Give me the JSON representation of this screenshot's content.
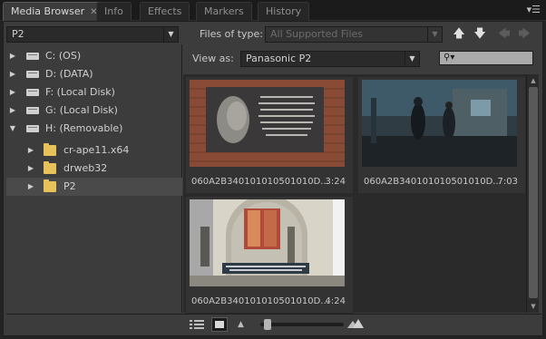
{
  "tabs": [
    {
      "label": "Media Browser",
      "active": true,
      "closable": true
    },
    {
      "label": "Info"
    },
    {
      "label": "Effects"
    },
    {
      "label": "Markers"
    },
    {
      "label": "History"
    }
  ],
  "panel_menu_icon": "panel-menu-icon",
  "location": {
    "value": "P2"
  },
  "files_of_type": {
    "label": "Files of type:",
    "value": "All Supported Files"
  },
  "view_as": {
    "label": "View as:",
    "value": "Panasonic P2"
  },
  "tree": [
    {
      "label": "C: (OS)",
      "type": "drive",
      "expanded": false
    },
    {
      "label": "D: (DATA)",
      "type": "drive",
      "expanded": false
    },
    {
      "label": "F: (Local Disk)",
      "type": "drive",
      "expanded": false
    },
    {
      "label": "G: (Local Disk)",
      "type": "drive",
      "expanded": false
    },
    {
      "label": "H: (Removable)",
      "type": "drive",
      "expanded": true
    },
    {
      "label": "cr-ape11.x64",
      "type": "folder",
      "expanded": false
    },
    {
      "label": "drweb32",
      "type": "folder",
      "expanded": false
    },
    {
      "label": "P2",
      "type": "folder",
      "expanded": false,
      "selected": true
    }
  ],
  "clips": [
    {
      "name": "060A2B340101010501010D...",
      "duration": "3:24"
    },
    {
      "name": "060A2B340101010501010D...",
      "duration": "7:03"
    },
    {
      "name": "060A2B340101010501010D...",
      "duration": "4:24"
    }
  ],
  "colors": {
    "accent": "#e7c25a",
    "panel": "#3c3c3c",
    "background": "#232323"
  },
  "thumbnail_zoom": 0.05
}
